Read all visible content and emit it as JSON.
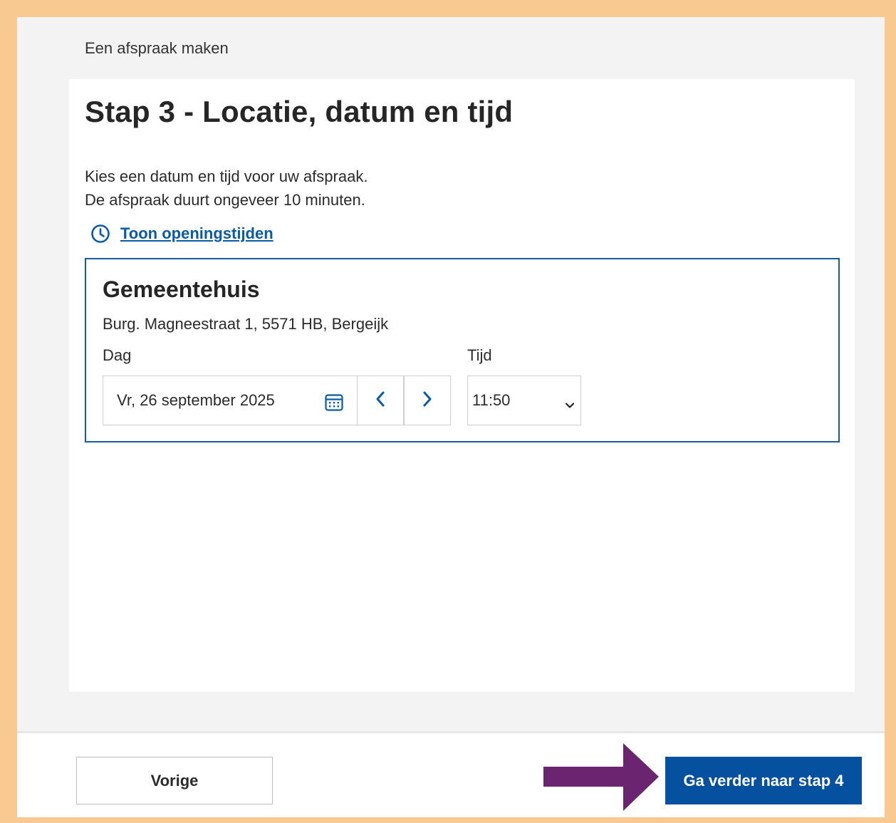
{
  "breadcrumb": "Een afspraak maken",
  "page": {
    "title": "Stap 3 - Locatie, datum en tijd",
    "intro_line1": "Kies een datum en tijd voor uw afspraak.",
    "intro_line2": "De afspraak duurt ongeveer 10 minuten.",
    "hours_link": "Toon openingstijden"
  },
  "location": {
    "name": "Gemeentehuis",
    "address": "Burg. Magneestraat 1, 5571 HB, Bergeijk",
    "day_label": "Dag",
    "time_label": "Tijd",
    "date_value": "Vr, 26 september 2025",
    "time_value": "11:50"
  },
  "footer": {
    "prev_label": "Vorige",
    "next_label": "Ga verder naar stap 4"
  },
  "colors": {
    "accent": "#0650a0",
    "link": "#0b5aa6",
    "frame": "#f8c990",
    "annotation_arrow": "#6b2470"
  },
  "icons": {
    "hours": "clock-icon",
    "date": "calendar-icon",
    "prev_day": "chevron-left-icon",
    "next_day": "chevron-right-icon",
    "time": "chevron-down-icon",
    "annotation": "arrow-right-icon"
  }
}
